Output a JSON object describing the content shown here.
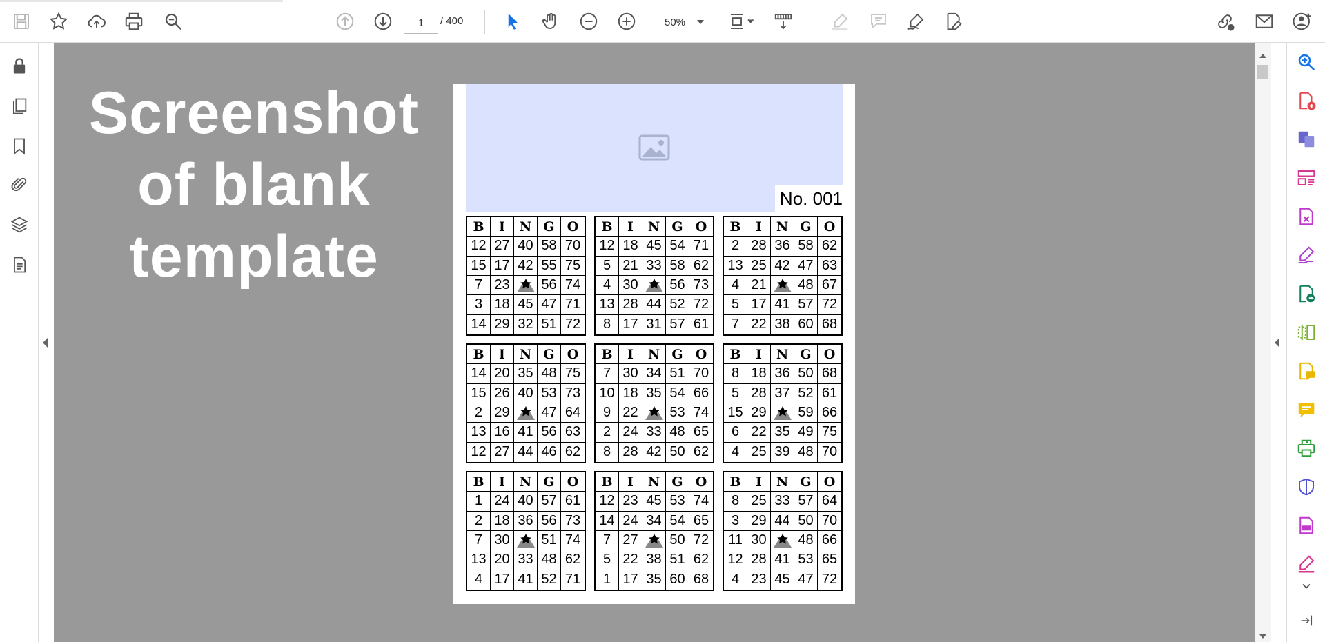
{
  "toolbar": {
    "left_icons": [
      "save-icon",
      "star-icon",
      "cloud-upload-icon",
      "print-icon",
      "search-icon"
    ],
    "nav_icons": [
      "page-up-icon",
      "page-down-icon"
    ],
    "current_page": "1",
    "total_pages": "/ 400",
    "select_tools": [
      "cursor-icon",
      "hand-icon",
      "zoom-out-icon",
      "zoom-in-icon"
    ],
    "zoom": "50%",
    "view_icons": [
      "fit-page-icon",
      "scroll-mode-icon"
    ],
    "annotate_icons": [
      "highlight-icon",
      "comment-icon",
      "sign-icon",
      "fill-sign-icon"
    ],
    "right_icons": [
      "share-link-icon",
      "email-icon",
      "account-icon"
    ]
  },
  "left_nav": [
    "lock-icon",
    "pages-icon",
    "bookmark-icon",
    "attachment-icon",
    "layers-icon",
    "document-properties-icon"
  ],
  "banner": {
    "lines": [
      "Screenshot",
      "of blank",
      "template"
    ]
  },
  "page": {
    "number_label": "No. 001",
    "header": [
      "B",
      "I",
      "N",
      "G",
      "O"
    ],
    "cards": [
      [
        [
          "12",
          "27",
          "40",
          "58",
          "70"
        ],
        [
          "15",
          "17",
          "42",
          "55",
          "75"
        ],
        [
          "7",
          "23",
          "FREE",
          "56",
          "74"
        ],
        [
          "3",
          "18",
          "45",
          "47",
          "71"
        ],
        [
          "14",
          "29",
          "32",
          "51",
          "72"
        ]
      ],
      [
        [
          "12",
          "18",
          "45",
          "54",
          "71"
        ],
        [
          "5",
          "21",
          "33",
          "58",
          "62"
        ],
        [
          "4",
          "30",
          "FREE",
          "56",
          "73"
        ],
        [
          "13",
          "28",
          "44",
          "52",
          "72"
        ],
        [
          "8",
          "17",
          "31",
          "57",
          "61"
        ]
      ],
      [
        [
          "2",
          "28",
          "36",
          "58",
          "62"
        ],
        [
          "13",
          "25",
          "42",
          "47",
          "63"
        ],
        [
          "4",
          "21",
          "FREE",
          "48",
          "67"
        ],
        [
          "5",
          "17",
          "41",
          "57",
          "72"
        ],
        [
          "7",
          "22",
          "38",
          "60",
          "68"
        ]
      ],
      [
        [
          "14",
          "20",
          "35",
          "48",
          "75"
        ],
        [
          "15",
          "26",
          "40",
          "53",
          "73"
        ],
        [
          "2",
          "29",
          "FREE",
          "47",
          "64"
        ],
        [
          "13",
          "16",
          "41",
          "56",
          "63"
        ],
        [
          "12",
          "27",
          "44",
          "46",
          "62"
        ]
      ],
      [
        [
          "7",
          "30",
          "34",
          "51",
          "70"
        ],
        [
          "10",
          "18",
          "35",
          "54",
          "66"
        ],
        [
          "9",
          "22",
          "FREE",
          "53",
          "74"
        ],
        [
          "2",
          "24",
          "33",
          "48",
          "65"
        ],
        [
          "8",
          "28",
          "42",
          "50",
          "62"
        ]
      ],
      [
        [
          "8",
          "18",
          "36",
          "50",
          "68"
        ],
        [
          "5",
          "28",
          "37",
          "52",
          "61"
        ],
        [
          "15",
          "29",
          "FREE",
          "59",
          "66"
        ],
        [
          "6",
          "22",
          "35",
          "49",
          "75"
        ],
        [
          "4",
          "25",
          "39",
          "48",
          "70"
        ]
      ],
      [
        [
          "1",
          "24",
          "40",
          "57",
          "61"
        ],
        [
          "2",
          "18",
          "36",
          "56",
          "73"
        ],
        [
          "7",
          "30",
          "FREE",
          "51",
          "74"
        ],
        [
          "13",
          "20",
          "33",
          "48",
          "62"
        ],
        [
          "4",
          "17",
          "41",
          "52",
          "71"
        ]
      ],
      [
        [
          "12",
          "23",
          "45",
          "53",
          "74"
        ],
        [
          "14",
          "24",
          "34",
          "54",
          "65"
        ],
        [
          "7",
          "27",
          "FREE",
          "50",
          "72"
        ],
        [
          "5",
          "22",
          "38",
          "51",
          "62"
        ],
        [
          "1",
          "17",
          "35",
          "60",
          "68"
        ]
      ],
      [
        [
          "8",
          "25",
          "33",
          "57",
          "64"
        ],
        [
          "3",
          "29",
          "44",
          "50",
          "70"
        ],
        [
          "11",
          "30",
          "FREE",
          "48",
          "66"
        ],
        [
          "12",
          "28",
          "41",
          "53",
          "65"
        ],
        [
          "4",
          "23",
          "45",
          "47",
          "72"
        ]
      ]
    ]
  },
  "right_panel": [
    "search-enhance-icon",
    "create-pdf-icon",
    "combine-files-icon",
    "organize-pages-icon",
    "export-pdf-icon",
    "edit-pdf-icon",
    "send-for-review-icon",
    "compare-icon",
    "comment-tool-icon",
    "stamp-icon",
    "print-production-icon",
    "protect-icon",
    "redact-icon",
    "fill-sign-tool-icon",
    "more-tools-icon",
    "expand-panel-icon"
  ],
  "colors": {
    "accent_blue": "#1473e6",
    "viewer_bg": "#999999",
    "image_placeholder": "#dbe2fd"
  }
}
